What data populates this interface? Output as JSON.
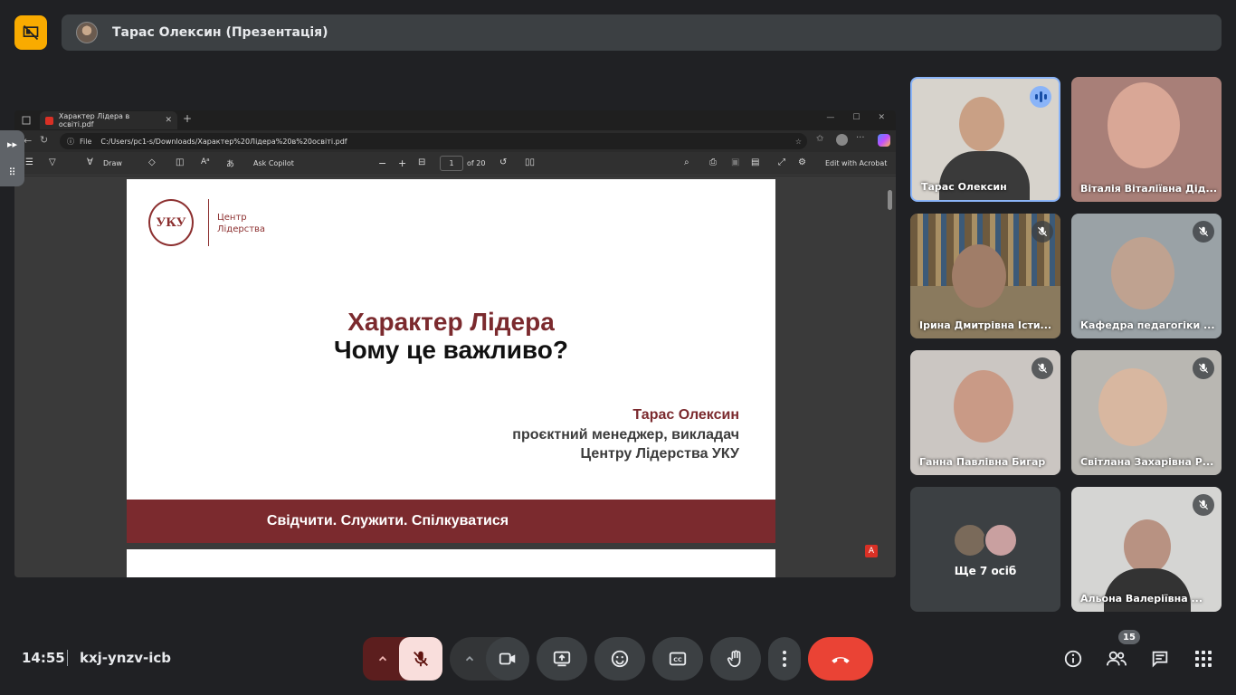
{
  "header": {
    "presenter_title": "Тарас Олексин (Презентація)"
  },
  "browser": {
    "tab_title": "Характер Лідера в освіті.pdf",
    "tab_close": "✕",
    "new_tab": "+",
    "address_label": "File",
    "address": "C:/Users/pc1-s/Downloads/Характер%20Лідера%20в%20освіті.pdf",
    "toolbar": {
      "draw": "Draw",
      "ask_copilot": "Ask Copilot",
      "zoom_out": "−",
      "zoom_in": "+",
      "page_current": "1",
      "page_total": "of 20",
      "edit_acrobat": "Edit with Acrobat"
    }
  },
  "slide": {
    "logo_text_line1": "Центр",
    "logo_text_line2": "Лідерства",
    "logo_monogram": "УКУ",
    "title": "Характер Лідера",
    "subtitle": "Чому це важливо?",
    "author": "Тарас Олексин",
    "role_line1": "проєктний менеджер, викладач",
    "role_line2": "Центру Лідерства УКУ",
    "motto": "Свідчити. Служити. Спілкуватися"
  },
  "participants": [
    {
      "name": "Тарас Олексин",
      "state": "speaking"
    },
    {
      "name": "Віталія Віталіївна Дід...",
      "state": "none"
    },
    {
      "name": "Ірина Дмитрівна Істи...",
      "state": "muted"
    },
    {
      "name": "Кафедра педагогіки ...",
      "state": "muted"
    },
    {
      "name": "Ганна Павлівна Бигар",
      "state": "muted"
    },
    {
      "name": "Світлана Захарівна Р...",
      "state": "muted"
    },
    {
      "name": "Ще 7 осіб",
      "state": "group"
    },
    {
      "name": "Альона Валеріївна ...",
      "state": "muted"
    }
  ],
  "footer": {
    "time": "14:55",
    "meeting_code": "kxj-ynzv-icb",
    "people_count": "15"
  },
  "colors": {
    "accent_brand": "#7b2a2e",
    "end_call": "#ea4335",
    "logo_yellow": "#f9ab00"
  },
  "icons": [
    "present-off-icon",
    "mic-off-icon",
    "camera-icon",
    "present-screen-icon",
    "emoji-icon",
    "captions-icon",
    "raise-hand-icon",
    "more-icon",
    "end-call-icon",
    "info-icon",
    "people-icon",
    "chat-icon",
    "activities-icon"
  ]
}
